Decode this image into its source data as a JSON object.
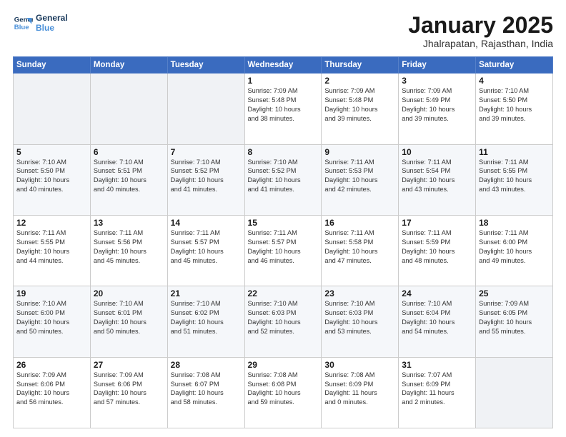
{
  "header": {
    "logo_line1": "General",
    "logo_line2": "Blue",
    "title": "January 2025",
    "subtitle": "Jhalrapatan, Rajasthan, India"
  },
  "weekdays": [
    "Sunday",
    "Monday",
    "Tuesday",
    "Wednesday",
    "Thursday",
    "Friday",
    "Saturday"
  ],
  "weeks": [
    [
      {
        "day": "",
        "info": ""
      },
      {
        "day": "",
        "info": ""
      },
      {
        "day": "",
        "info": ""
      },
      {
        "day": "1",
        "info": "Sunrise: 7:09 AM\nSunset: 5:48 PM\nDaylight: 10 hours\nand 38 minutes."
      },
      {
        "day": "2",
        "info": "Sunrise: 7:09 AM\nSunset: 5:48 PM\nDaylight: 10 hours\nand 39 minutes."
      },
      {
        "day": "3",
        "info": "Sunrise: 7:09 AM\nSunset: 5:49 PM\nDaylight: 10 hours\nand 39 minutes."
      },
      {
        "day": "4",
        "info": "Sunrise: 7:10 AM\nSunset: 5:50 PM\nDaylight: 10 hours\nand 39 minutes."
      }
    ],
    [
      {
        "day": "5",
        "info": "Sunrise: 7:10 AM\nSunset: 5:50 PM\nDaylight: 10 hours\nand 40 minutes."
      },
      {
        "day": "6",
        "info": "Sunrise: 7:10 AM\nSunset: 5:51 PM\nDaylight: 10 hours\nand 40 minutes."
      },
      {
        "day": "7",
        "info": "Sunrise: 7:10 AM\nSunset: 5:52 PM\nDaylight: 10 hours\nand 41 minutes."
      },
      {
        "day": "8",
        "info": "Sunrise: 7:10 AM\nSunset: 5:52 PM\nDaylight: 10 hours\nand 41 minutes."
      },
      {
        "day": "9",
        "info": "Sunrise: 7:11 AM\nSunset: 5:53 PM\nDaylight: 10 hours\nand 42 minutes."
      },
      {
        "day": "10",
        "info": "Sunrise: 7:11 AM\nSunset: 5:54 PM\nDaylight: 10 hours\nand 43 minutes."
      },
      {
        "day": "11",
        "info": "Sunrise: 7:11 AM\nSunset: 5:55 PM\nDaylight: 10 hours\nand 43 minutes."
      }
    ],
    [
      {
        "day": "12",
        "info": "Sunrise: 7:11 AM\nSunset: 5:55 PM\nDaylight: 10 hours\nand 44 minutes."
      },
      {
        "day": "13",
        "info": "Sunrise: 7:11 AM\nSunset: 5:56 PM\nDaylight: 10 hours\nand 45 minutes."
      },
      {
        "day": "14",
        "info": "Sunrise: 7:11 AM\nSunset: 5:57 PM\nDaylight: 10 hours\nand 45 minutes."
      },
      {
        "day": "15",
        "info": "Sunrise: 7:11 AM\nSunset: 5:57 PM\nDaylight: 10 hours\nand 46 minutes."
      },
      {
        "day": "16",
        "info": "Sunrise: 7:11 AM\nSunset: 5:58 PM\nDaylight: 10 hours\nand 47 minutes."
      },
      {
        "day": "17",
        "info": "Sunrise: 7:11 AM\nSunset: 5:59 PM\nDaylight: 10 hours\nand 48 minutes."
      },
      {
        "day": "18",
        "info": "Sunrise: 7:11 AM\nSunset: 6:00 PM\nDaylight: 10 hours\nand 49 minutes."
      }
    ],
    [
      {
        "day": "19",
        "info": "Sunrise: 7:10 AM\nSunset: 6:00 PM\nDaylight: 10 hours\nand 50 minutes."
      },
      {
        "day": "20",
        "info": "Sunrise: 7:10 AM\nSunset: 6:01 PM\nDaylight: 10 hours\nand 50 minutes."
      },
      {
        "day": "21",
        "info": "Sunrise: 7:10 AM\nSunset: 6:02 PM\nDaylight: 10 hours\nand 51 minutes."
      },
      {
        "day": "22",
        "info": "Sunrise: 7:10 AM\nSunset: 6:03 PM\nDaylight: 10 hours\nand 52 minutes."
      },
      {
        "day": "23",
        "info": "Sunrise: 7:10 AM\nSunset: 6:03 PM\nDaylight: 10 hours\nand 53 minutes."
      },
      {
        "day": "24",
        "info": "Sunrise: 7:10 AM\nSunset: 6:04 PM\nDaylight: 10 hours\nand 54 minutes."
      },
      {
        "day": "25",
        "info": "Sunrise: 7:09 AM\nSunset: 6:05 PM\nDaylight: 10 hours\nand 55 minutes."
      }
    ],
    [
      {
        "day": "26",
        "info": "Sunrise: 7:09 AM\nSunset: 6:06 PM\nDaylight: 10 hours\nand 56 minutes."
      },
      {
        "day": "27",
        "info": "Sunrise: 7:09 AM\nSunset: 6:06 PM\nDaylight: 10 hours\nand 57 minutes."
      },
      {
        "day": "28",
        "info": "Sunrise: 7:08 AM\nSunset: 6:07 PM\nDaylight: 10 hours\nand 58 minutes."
      },
      {
        "day": "29",
        "info": "Sunrise: 7:08 AM\nSunset: 6:08 PM\nDaylight: 10 hours\nand 59 minutes."
      },
      {
        "day": "30",
        "info": "Sunrise: 7:08 AM\nSunset: 6:09 PM\nDaylight: 11 hours\nand 0 minutes."
      },
      {
        "day": "31",
        "info": "Sunrise: 7:07 AM\nSunset: 6:09 PM\nDaylight: 11 hours\nand 2 minutes."
      },
      {
        "day": "",
        "info": ""
      }
    ]
  ]
}
